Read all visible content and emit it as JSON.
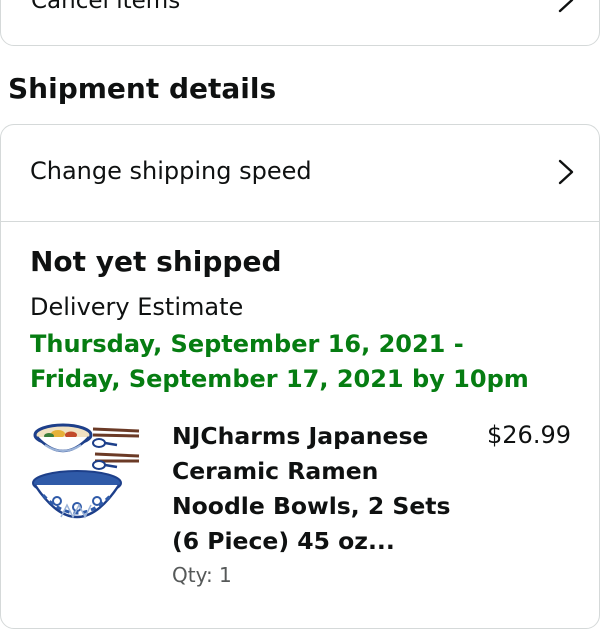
{
  "cancel_row": {
    "label": "Cancel items"
  },
  "section": {
    "title": "Shipment details"
  },
  "shipping_speed": {
    "label": "Change shipping speed"
  },
  "shipment": {
    "status": "Not yet shipped",
    "estimate_label": "Delivery Estimate",
    "delivery_window": "Thursday, September 16, 2021 - Friday, September 17, 2021 by 10pm",
    "status_color": "#067d12"
  },
  "product": {
    "title": "NJCharms Japanese Ceramic Ramen Noodle Bowls, 2 Sets (6 Piece) 45 oz...",
    "price": "$26.99",
    "qty": "Qty: 1",
    "image_icon": "ramen-bowls-image"
  },
  "icons": {
    "row_chevron": "chevron-right-icon"
  }
}
